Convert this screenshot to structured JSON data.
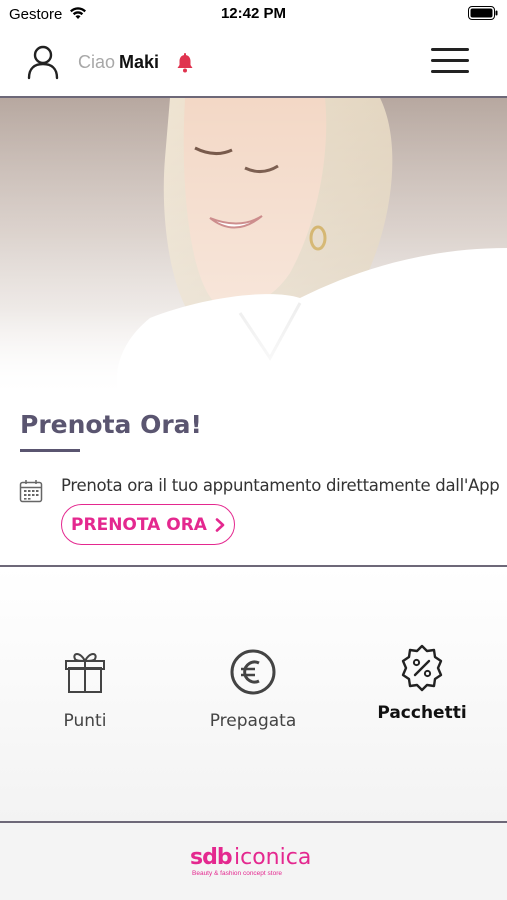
{
  "status_bar": {
    "carrier": "Gestore",
    "time": "12:42 PM"
  },
  "header": {
    "greeting": "Ciao",
    "user_name": "Maki"
  },
  "booking": {
    "title": "Prenota Ora!",
    "description": "Prenota ora il tuo appuntamento direttamente dall'App",
    "button_label": "PRENOTA ORA"
  },
  "features": [
    {
      "label": "Punti",
      "icon": "gift-icon"
    },
    {
      "label": "Prepagata",
      "icon": "euro-icon"
    },
    {
      "label": "Pacchetti",
      "icon": "discount-badge-icon"
    }
  ],
  "footer": {
    "logo_mark": "sdb",
    "logo_name": "iconica",
    "logo_tagline": "Beauty & fashion concept store"
  },
  "colors": {
    "accent": "#e4288f",
    "title": "#5a5570",
    "divider": "#6d6878",
    "bell": "#e0334f"
  }
}
